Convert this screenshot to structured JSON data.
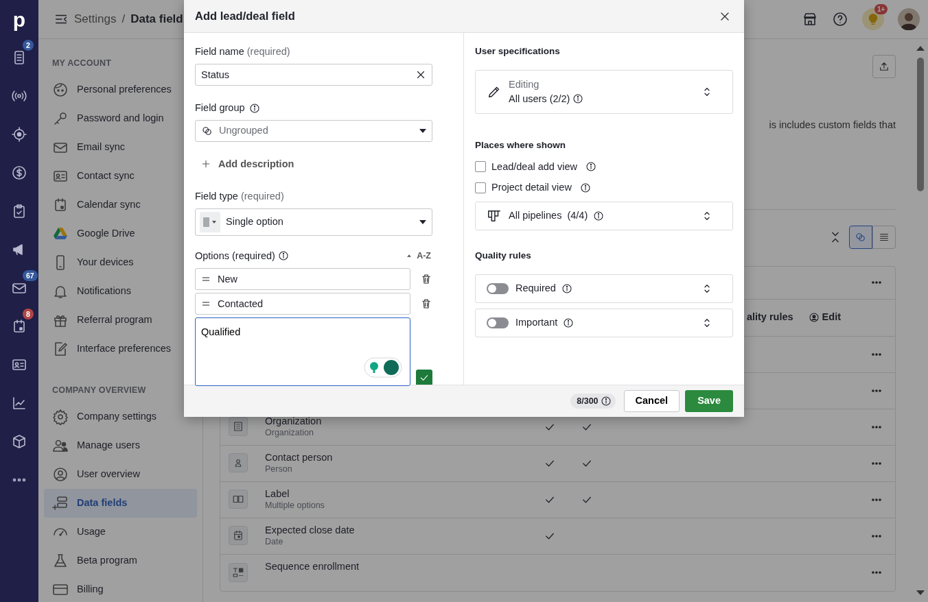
{
  "topbar": {
    "breadcrumb": [
      {
        "label": "Settings",
        "current": false
      },
      {
        "label": "Data field",
        "current": true
      }
    ],
    "separator": "/",
    "notification_badge": "1+"
  },
  "rail": {
    "logo": "p",
    "items": [
      {
        "kind": "document",
        "badge": "2",
        "color": "#35589c"
      },
      {
        "kind": "broadcast"
      },
      {
        "kind": "target"
      },
      {
        "kind": "dollar"
      },
      {
        "kind": "clipboard"
      },
      {
        "kind": "megaphone"
      },
      {
        "kind": "mail",
        "badge": "67",
        "color": "#35589c"
      },
      {
        "kind": "calendar",
        "badge": "8",
        "color": "#b04545"
      },
      {
        "kind": "card"
      },
      {
        "kind": "chart"
      },
      {
        "kind": "box"
      },
      {
        "kind": "more"
      }
    ]
  },
  "sidebar": {
    "sections": [
      {
        "title": "MY ACCOUNT",
        "items": [
          {
            "kind": "face",
            "label": "Personal preferences",
            "selected": false
          },
          {
            "kind": "key",
            "label": "Password and login",
            "selected": false
          },
          {
            "kind": "mail",
            "label": "Email sync",
            "selected": false
          },
          {
            "kind": "card",
            "label": "Contact sync",
            "selected": false
          },
          {
            "kind": "calendar",
            "label": "Calendar sync",
            "selected": false
          },
          {
            "kind": "drive",
            "label": "Google Drive",
            "selected": false
          },
          {
            "kind": "phone",
            "label": "Your devices",
            "selected": false
          },
          {
            "kind": "bell",
            "label": "Notifications",
            "selected": false
          },
          {
            "kind": "gift",
            "label": "Referral program",
            "selected": false
          },
          {
            "kind": "edit",
            "label": "Interface preferences",
            "selected": false
          }
        ]
      },
      {
        "title": "COMPANY OVERVIEW",
        "items": [
          {
            "kind": "gear",
            "label": "Company settings",
            "selected": false
          },
          {
            "kind": "users",
            "label": "Manage users",
            "selected": false
          },
          {
            "kind": "user",
            "label": "User overview",
            "selected": false
          },
          {
            "kind": "fields",
            "label": "Data fields",
            "selected": true
          },
          {
            "kind": "gauge",
            "label": "Usage",
            "selected": false
          },
          {
            "kind": "flask",
            "label": "Beta program",
            "selected": false
          },
          {
            "kind": "creditcard",
            "label": "Billing",
            "selected": false
          }
        ]
      }
    ]
  },
  "main": {
    "description": "is includes custom fields that",
    "view_toggle": [
      {
        "kind": "groups",
        "selected": true
      },
      {
        "kind": "list",
        "selected": false
      }
    ],
    "rows": [
      {
        "kind": "covered"
      },
      {
        "kind": "header",
        "columns": [
          "ality rules",
          "Edit"
        ]
      },
      {
        "kind": "covered"
      },
      {
        "kind": "covered"
      },
      {
        "kind": "organization",
        "title": "Organization",
        "subtitle": "Organization",
        "checks": [
          true,
          true
        ]
      },
      {
        "kind": "person",
        "title": "Contact person",
        "subtitle": "Person",
        "checks": [
          true,
          true
        ]
      },
      {
        "kind": "labels",
        "title": "Label",
        "subtitle": "Multiple options",
        "checks": [
          true,
          true
        ]
      },
      {
        "kind": "date",
        "title": "Expected close date",
        "subtitle": "Date",
        "checks": [
          true,
          false
        ]
      },
      {
        "kind": "sequence",
        "title": "Sequence enrollment",
        "checks": [
          false,
          false
        ]
      }
    ]
  },
  "modal": {
    "title": "Add lead/deal field",
    "field_name": {
      "label": "Field name",
      "hint": "(required)",
      "value": "Status"
    },
    "field_group": {
      "label": "Field group",
      "value": "Ungrouped"
    },
    "add_description": "Add description",
    "field_type": {
      "label": "Field type",
      "hint": "(required)",
      "value": "Single option"
    },
    "options": {
      "label": "Options (required)",
      "sort": "A-Z",
      "items": [
        {
          "value": "New"
        },
        {
          "value": "Contacted"
        }
      ],
      "new_option": "Qualified"
    },
    "user_specifications": {
      "title": "User specifications",
      "caption": "Editing",
      "value": "All users (2/2)"
    },
    "places": {
      "title": "Places where shown",
      "checkboxes": [
        {
          "label": "Lead/deal add view",
          "checked": false
        },
        {
          "label": "Project detail view",
          "checked": false
        }
      ],
      "pipelines": "All pipelines  (4/4)"
    },
    "quality_rules": {
      "title": "Quality rules",
      "rules": [
        {
          "label": "Required",
          "on": false
        },
        {
          "label": "Important",
          "on": false
        }
      ]
    },
    "counter": "8/300",
    "cancel": "Cancel",
    "save": "Save"
  }
}
